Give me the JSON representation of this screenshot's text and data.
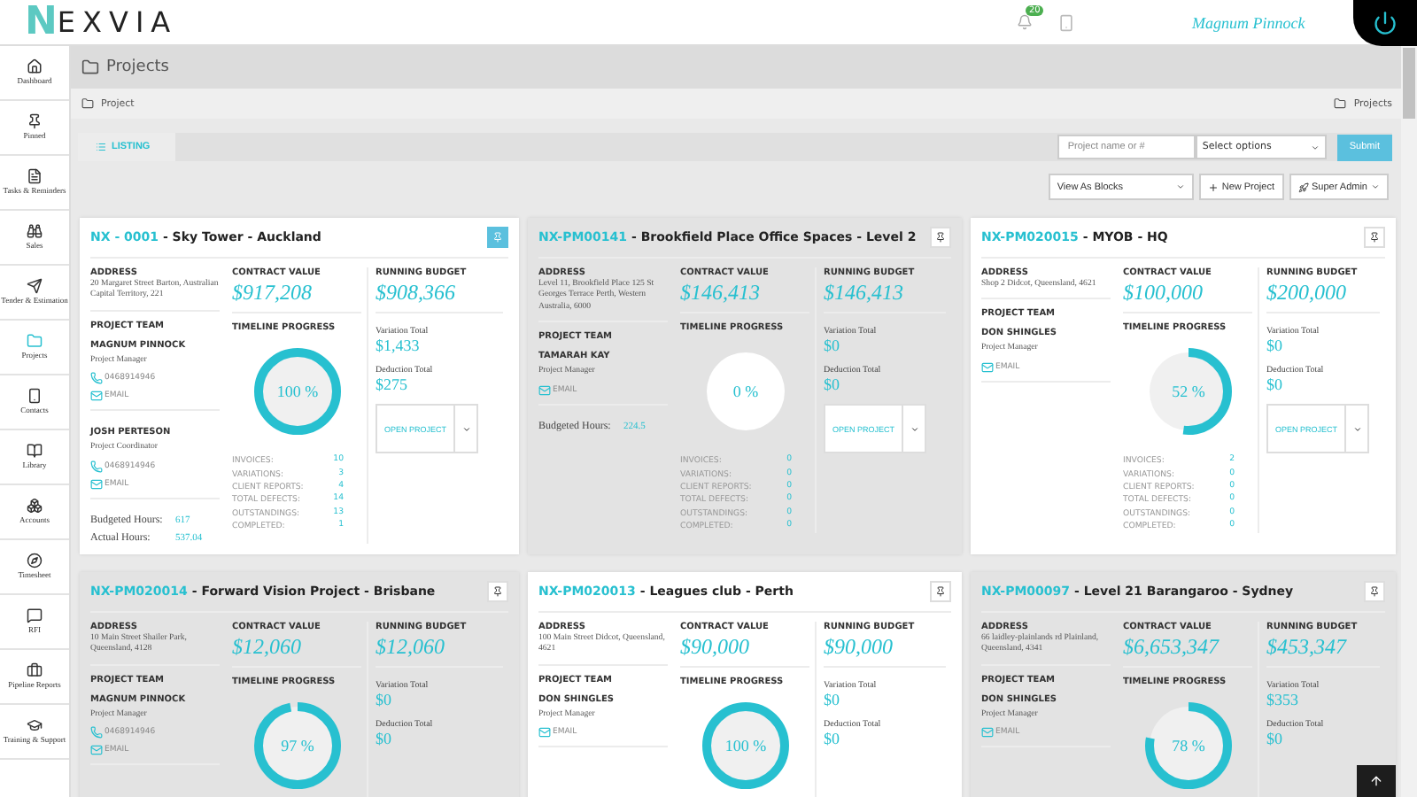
{
  "header": {
    "logo_initial": "N",
    "logo_rest": "EXVIA",
    "notification_count": "20",
    "user": "Magnum Pinnock"
  },
  "sidebar": {
    "items": [
      {
        "label": "Dashboard",
        "selected": false
      },
      {
        "label": "Pinned",
        "selected": false
      },
      {
        "label": "Tasks & Reminders",
        "selected": false
      },
      {
        "label": "Sales",
        "selected": false
      },
      {
        "label": "Tender & Estimation",
        "selected": false
      },
      {
        "label": "Projects",
        "selected": true
      },
      {
        "label": "Contacts",
        "selected": false
      },
      {
        "label": "Library",
        "selected": false
      },
      {
        "label": "Accounts",
        "selected": false
      },
      {
        "label": "Timesheet",
        "selected": false
      },
      {
        "label": "RFI",
        "selected": false
      },
      {
        "label": "Pipeline Reports",
        "selected": false
      },
      {
        "label": "Training & Support",
        "selected": false
      }
    ]
  },
  "page_title": "Projects",
  "breadcrumb": {
    "left": "Project",
    "right": "Projects"
  },
  "tabs": [
    {
      "label": "LISTING",
      "selected": true
    }
  ],
  "search": {
    "placeholder": "Project name or #",
    "select": "Select options",
    "submit": "Submit"
  },
  "toolbar": {
    "view": "View As Blocks",
    "new_project": "New Project",
    "admin": "Super Admin"
  },
  "cards": [
    {
      "code": "NX - 0001",
      "title": " - Sky Tower - Auckland",
      "pinned": true,
      "labels": {
        "address": "ADDRESS",
        "team": "PROJECT TEAM",
        "contract": "CONTRACT VALUE",
        "budget": "RUNNING BUDGET",
        "timeline": "TIMELINE PROGRESS",
        "variation": "Variation Total",
        "deduction": "Deduction Total"
      },
      "address": "20 Margaret Street Barton, Australian Capital Territory, 221",
      "members": [
        {
          "name": "MAGNUM PINNOCK",
          "role": "Project Manager",
          "phone": "0468914946",
          "email": "EMAIL"
        },
        {
          "name": "JOSH PERTESON",
          "role": "Project Coordinator",
          "phone": "0468914946",
          "email": "EMAIL"
        }
      ],
      "hours": [
        {
          "label": "Budgeted Hours:",
          "value": "617"
        },
        {
          "label": "Actual Hours:",
          "value": "537.04"
        }
      ],
      "contract": "$917,208",
      "budget": "$908,366",
      "variation": "$1,433",
      "deduction": "$275",
      "level": 1,
      "progress": "100 %",
      "stats": [
        {
          "label": "INVOICES:",
          "value": "10"
        },
        {
          "label": "VARIATIONS:",
          "value": "3"
        },
        {
          "label": "CLIENT REPORTS:",
          "value": "4"
        },
        {
          "label": "TOTAL DEFECTS:",
          "value": "14"
        },
        {
          "label": "OUTSTANDINGS:",
          "value": "13"
        },
        {
          "label": "COMPLETED:",
          "value": "1"
        }
      ],
      "open": "OPEN PROJECT"
    },
    {
      "code": "NX-PM00141",
      "title": " - Brookfield Place Office Spaces - Level 2",
      "pinned": false,
      "labels": {
        "address": "ADDRESS",
        "team": "PROJECT TEAM",
        "contract": "CONTRACT VALUE",
        "budget": "RUNNING BUDGET",
        "timeline": "TIMELINE PROGRESS",
        "variation": "Variation Total",
        "deduction": "Deduction Total"
      },
      "address": "Level 11, Brookfield Place 125 St Georges Terrace Perth, Western Australia, 6000",
      "members": [
        {
          "name": "TAMARAH KAY",
          "role": "Project Manager",
          "email": "EMAIL"
        }
      ],
      "hours": [
        {
          "label": "Budgeted Hours:",
          "value": "224.5"
        }
      ],
      "contract": "$146,413",
      "budget": "$146,413",
      "variation": "$0",
      "deduction": "$0",
      "level": 0,
      "progress": "0 %",
      "stats": [
        {
          "label": "INVOICES:",
          "value": "0"
        },
        {
          "label": "VARIATIONS:",
          "value": "0"
        },
        {
          "label": "CLIENT REPORTS:",
          "value": "0"
        },
        {
          "label": "TOTAL DEFECTS:",
          "value": "0"
        },
        {
          "label": "OUTSTANDINGS:",
          "value": "0"
        },
        {
          "label": "COMPLETED:",
          "value": "0"
        }
      ],
      "open": "OPEN PROJECT"
    },
    {
      "code": "NX-PM020015",
      "title": " - MYOB - HQ",
      "pinned": false,
      "labels": {
        "address": "ADDRESS",
        "team": "PROJECT TEAM",
        "contract": "CONTRACT VALUE",
        "budget": "RUNNING BUDGET",
        "timeline": "TIMELINE PROGRESS",
        "variation": "Variation Total",
        "deduction": "Deduction Total"
      },
      "address": "Shop 2 Didcot, Queensland, 4621",
      "members": [
        {
          "name": "DON SHINGLES",
          "role": "Project Manager",
          "email": "EMAIL"
        }
      ],
      "contract": "$100,000",
      "budget": "$200,000",
      "variation": "$0",
      "deduction": "$0",
      "level": 0.52,
      "progress": "52 %",
      "stats": [
        {
          "label": "INVOICES:",
          "value": "2"
        },
        {
          "label": "VARIATIONS:",
          "value": "0"
        },
        {
          "label": "CLIENT REPORTS:",
          "value": "0"
        },
        {
          "label": "TOTAL DEFECTS:",
          "value": "0"
        },
        {
          "label": "OUTSTANDINGS:",
          "value": "0"
        },
        {
          "label": "COMPLETED:",
          "value": "0"
        }
      ],
      "open": "OPEN PROJECT"
    },
    {
      "code": "NX-PM020014",
      "title": " - Forward Vision Project - Brisbane",
      "pinned": false,
      "labels": {
        "address": "ADDRESS",
        "team": "PROJECT TEAM",
        "contract": "CONTRACT VALUE",
        "budget": "RUNNING BUDGET",
        "timeline": "TIMELINE PROGRESS",
        "variation": "Variation Total",
        "deduction": "Deduction Total"
      },
      "address": "10 Main Street Shailer Park, Queensland, 4128",
      "members": [
        {
          "name": "MAGNUM PINNOCK",
          "role": "Project Manager",
          "phone": "0468914946",
          "email": "EMAIL"
        }
      ],
      "contract": "$12,060",
      "budget": "$12,060",
      "variation": "$0",
      "deduction": "$0",
      "level": 0.97,
      "progress": "97 %"
    },
    {
      "code": "NX-PM020013",
      "title": " - Leagues club - Perth",
      "pinned": false,
      "labels": {
        "address": "ADDRESS",
        "team": "PROJECT TEAM",
        "contract": "CONTRACT VALUE",
        "budget": "RUNNING BUDGET",
        "timeline": "TIMELINE PROGRESS",
        "variation": "Variation Total",
        "deduction": "Deduction Total"
      },
      "address": "100 Main Street Didcot, Queensland, 4621",
      "members": [
        {
          "name": "DON SHINGLES",
          "role": "Project Manager",
          "email": "EMAIL"
        }
      ],
      "contract": "$90,000",
      "budget": "$90,000",
      "variation": "$0",
      "deduction": "$0",
      "level": 1,
      "progress": "100 %"
    },
    {
      "code": "NX-PM00097",
      "title": " - Level 21 Barangaroo - Sydney",
      "pinned": false,
      "labels": {
        "address": "ADDRESS",
        "team": "PROJECT TEAM",
        "contract": "CONTRACT VALUE",
        "budget": "RUNNING BUDGET",
        "timeline": "TIMELINE PROGRESS",
        "variation": "Variation Total",
        "deduction": "Deduction Total"
      },
      "address": "66 laidley-plainlands rd Plainland, Queensland, 4341",
      "members": [
        {
          "name": "DON SHINGLES",
          "role": "Project Manager",
          "email": "EMAIL"
        }
      ],
      "contract": "$6,653,347",
      "budget": "$453,347",
      "variation": "$353",
      "deduction": "$0",
      "level": 0.78,
      "progress": "78 %"
    }
  ]
}
